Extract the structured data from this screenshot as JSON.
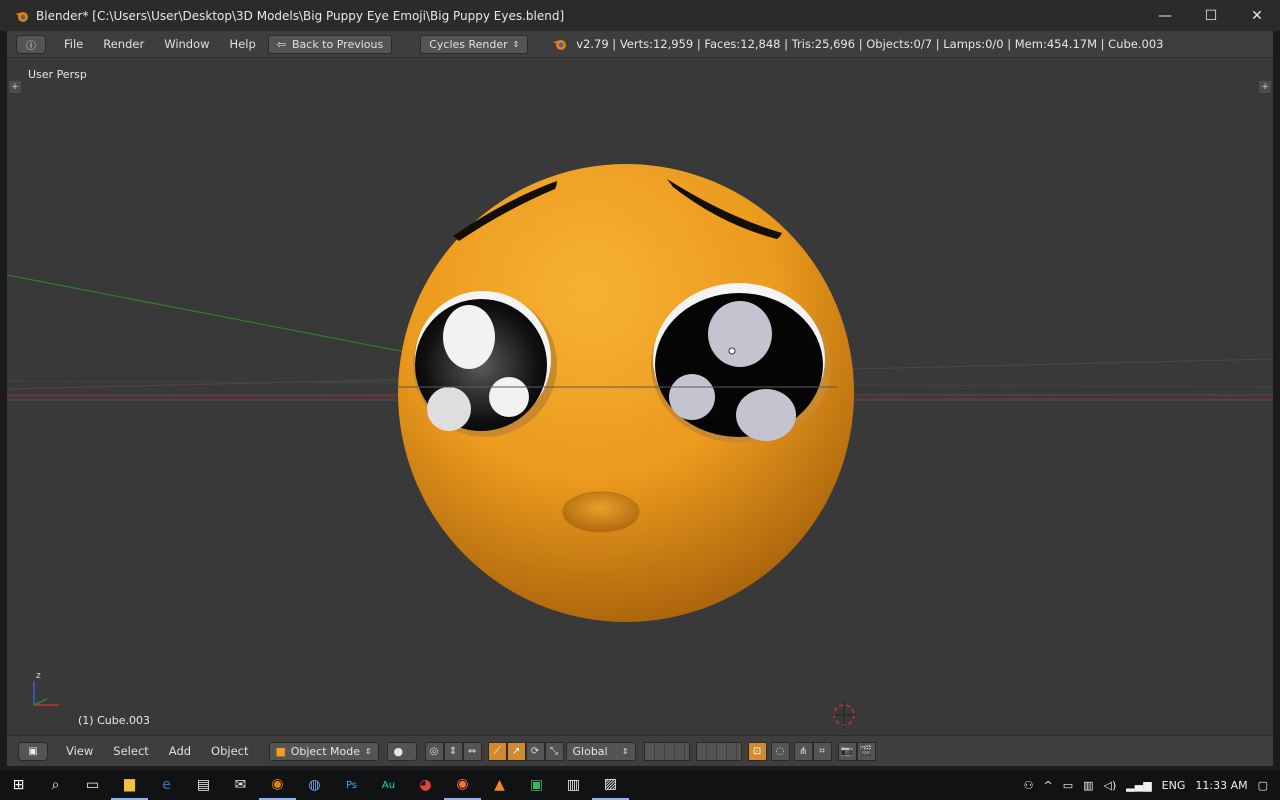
{
  "window": {
    "title": "Blender* [C:\\Users\\User\\Desktop\\3D Models\\Big Puppy Eye Emoji\\Big Puppy Eyes.blend]",
    "minimize": "—",
    "maximize": "☐",
    "close": "✕"
  },
  "topbar": {
    "menus": [
      "File",
      "Render",
      "Window",
      "Help"
    ],
    "back_button": "Back to Previous",
    "render_engine": "Cycles Render",
    "stats": "v2.79 | Verts:12,959 | Faces:12,848 | Tris:25,696 | Objects:0/7 | Lamps:0/0 | Mem:454.17M | Cube.003"
  },
  "viewport": {
    "view_label": "User Persp",
    "object_label": "(1) Cube.003",
    "axis_z": "z",
    "accent": "#f0a020"
  },
  "bottombar": {
    "menus": [
      "View",
      "Select",
      "Add",
      "Object"
    ],
    "mode": "Object Mode",
    "orientation": "Global"
  },
  "taskbar": {
    "lang": "ENG",
    "time": "11:33 AM",
    "apps": [
      "file-explorer-icon",
      "edge-icon",
      "store-icon",
      "mail-icon",
      "blender-icon",
      "app-icon",
      "photoshop-icon",
      "audition-icon",
      "chrome-icon",
      "firefox-icon",
      "vlc-icon",
      "app2-icon",
      "app3-icon",
      "photos-icon"
    ]
  }
}
